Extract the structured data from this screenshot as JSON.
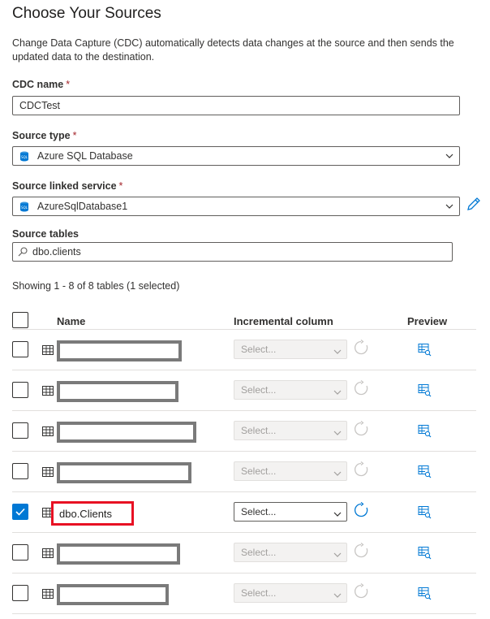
{
  "page": {
    "title": "Choose Your Sources",
    "description": "Change Data Capture (CDC) automatically detects data changes at the source and then sends the updated data to the destination."
  },
  "form": {
    "cdc_name_label": "CDC name",
    "cdc_name_value": "CDCTest",
    "source_type_label": "Source type",
    "source_type_value": "Azure SQL Database",
    "linked_service_label": "Source linked service",
    "linked_service_value": "AzureSqlDatabase1",
    "source_tables_label": "Source tables",
    "search_value": "dbo.clients",
    "required_mark": "*"
  },
  "table": {
    "showing_text": "Showing 1 - 8 of 8 tables (1 selected)",
    "headers": {
      "name": "Name",
      "incremental": "Incremental column",
      "preview": "Preview"
    },
    "select_placeholder": "Select...",
    "rows": [
      {
        "name": "",
        "checked": false,
        "redacted": true
      },
      {
        "name": "",
        "checked": false,
        "redacted": true
      },
      {
        "name": "",
        "checked": false,
        "redacted": true
      },
      {
        "name": "",
        "checked": false,
        "redacted": true
      },
      {
        "name": "dbo.Clients",
        "checked": true,
        "redacted": false
      },
      {
        "name": "",
        "checked": false,
        "redacted": true
      },
      {
        "name": "",
        "checked": false,
        "redacted": true
      }
    ]
  },
  "colors": {
    "accent": "#0078d4",
    "required": "#a4262c",
    "highlight": "#e81123",
    "redaction": "#7a7a7a"
  },
  "icons": {
    "source_type": "sql-database-icon",
    "linked_service": "sql-database-icon",
    "edit": "pencil-icon",
    "search": "search-icon",
    "table": "table-icon",
    "refresh": "refresh-icon",
    "preview": "preview-icon",
    "dropdown": "chevron-down-icon",
    "check": "checkmark-icon"
  }
}
